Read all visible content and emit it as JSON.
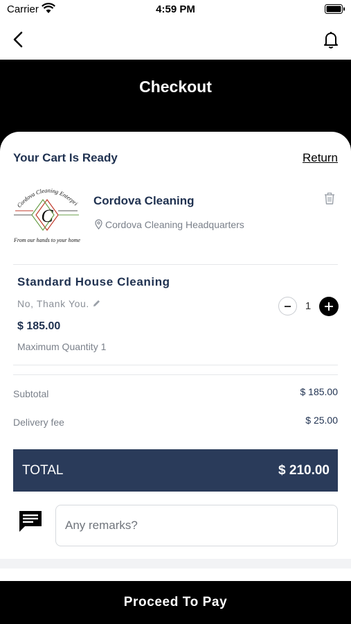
{
  "status_bar": {
    "carrier": "Carrier",
    "time": "4:59 PM"
  },
  "nav": {
    "back_icon": "chevron-left-icon",
    "bell_icon": "bell-icon"
  },
  "header": {
    "title": "Checkout"
  },
  "cart": {
    "heading": "Your Cart Is Ready",
    "return_label": "Return",
    "store": {
      "logo_text_top": "Cordova Cleaning Enterprises",
      "logo_letter": "C",
      "logo_tagline": "From our hands to your home",
      "name": "Cordova Cleaning",
      "location": "Cordova Cleaning Headquarters"
    },
    "item": {
      "name": "Standard House Cleaning",
      "note": "No, Thank You.",
      "price": "$ 185.00",
      "max_quantity": "Maximum Quantity 1",
      "quantity": "1"
    }
  },
  "summary": {
    "subtotal_label": "Subtotal",
    "subtotal_value": "$ 185.00",
    "delivery_label": "Delivery fee",
    "delivery_value": "$ 25.00",
    "total_label": "TOTAL",
    "total_value": "$ 210.00"
  },
  "remarks": {
    "placeholder": "Any remarks?"
  },
  "footer": {
    "pay_label": "Proceed To Pay"
  },
  "colors": {
    "navy": "#2a3b5a",
    "text_navy": "#1f3150",
    "black": "#000000"
  }
}
